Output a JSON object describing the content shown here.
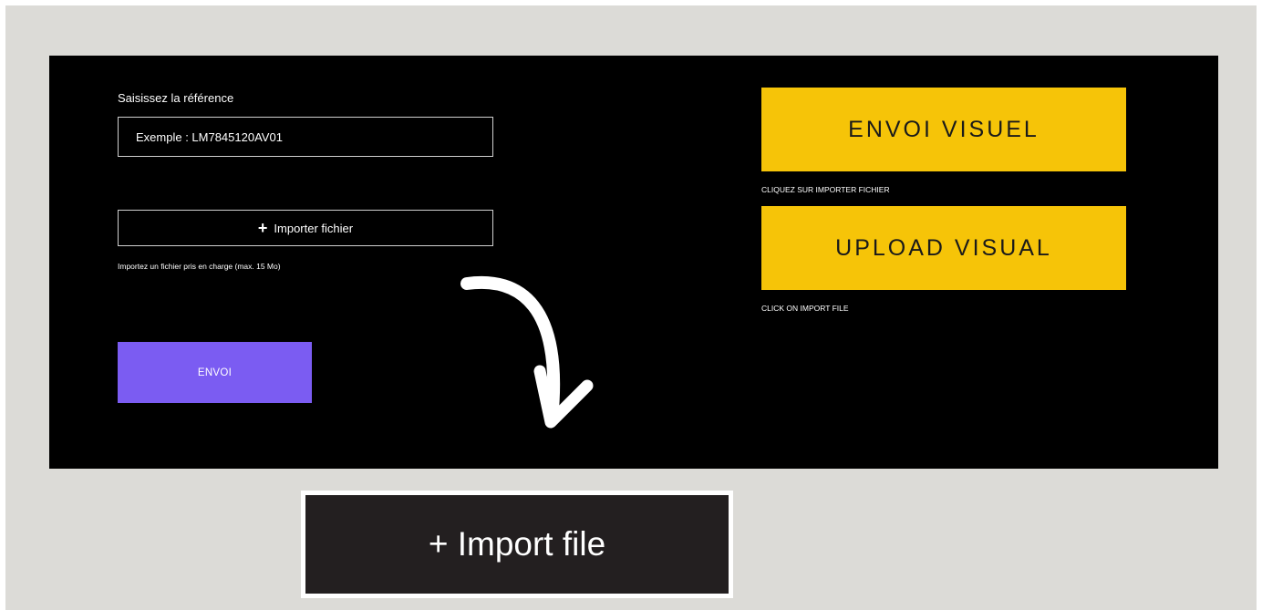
{
  "form": {
    "reference_label": "Saisissez la référence",
    "reference_placeholder": "Exemple : LM7845120AV01",
    "import_icon": "+",
    "import_label": "Importer fichier",
    "import_hint": "Importez un fichier pris en charge (max. 15 Mo)",
    "submit_label": "ENVOI"
  },
  "instructions": {
    "fr_title": "ENVOI VISUEL",
    "fr_caption": "CLIQUEZ SUR IMPORTER FICHIER",
    "en_title": "UPLOAD VISUAL",
    "en_caption": "CLICK ON IMPORT FILE"
  },
  "callout": {
    "label": "+ Import file",
    "arrow_icon": "curved-arrow-down-icon"
  },
  "colors": {
    "background": "#dcdbd7",
    "panel": "#000000",
    "accent_yellow": "#f6c408",
    "submit_purple": "#7b5cf2",
    "callout_bg": "#231f20"
  }
}
